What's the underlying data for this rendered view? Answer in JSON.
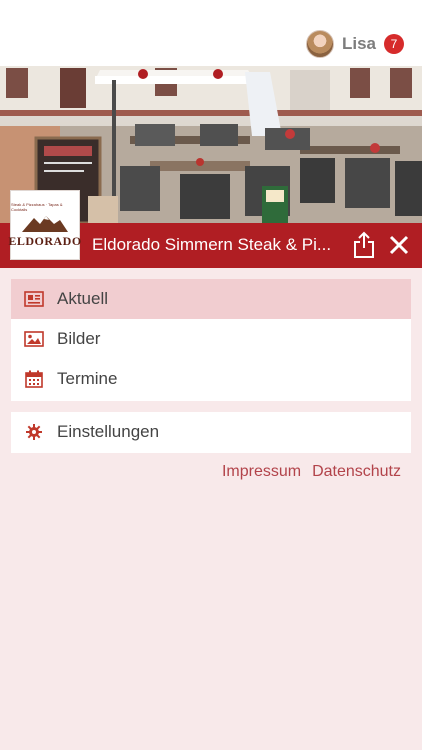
{
  "user": {
    "name": "Lisa",
    "notifications": "7"
  },
  "place": {
    "title": "Eldorado Simmern Steak & Pi...",
    "logo_text": "ELDORADO",
    "logo_tagline": "Steak & Pizzahaus · Tapas & Cocktails"
  },
  "menu": [
    {
      "label": "Aktuell",
      "icon": "newspaper-icon",
      "active": true
    },
    {
      "label": "Bilder",
      "icon": "image-icon",
      "active": false
    },
    {
      "label": "Termine",
      "icon": "calendar-icon",
      "active": false
    }
  ],
  "settings": {
    "label": "Einstellungen",
    "icon": "gear-icon"
  },
  "footer_links": {
    "impressum": "Impressum",
    "datenschutz": "Datenschutz"
  },
  "colors": {
    "brand": "#b01e23",
    "background": "#f8e9ea",
    "active_row": "#f1cdd0",
    "link": "#b2434a"
  }
}
